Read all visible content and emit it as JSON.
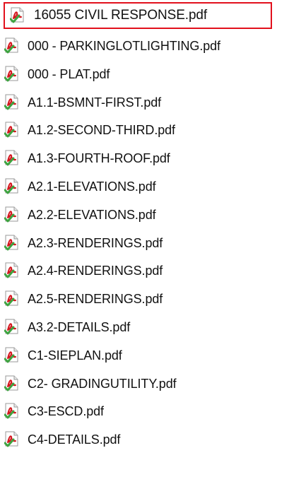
{
  "highlight_color": "#e2101c",
  "icon": {
    "name": "pdf-file-icon",
    "page_color": "#ffffff",
    "page_border": "#9a9a9a",
    "acrobat_red": "#d4181f",
    "sync_check_green": "#3ea340"
  },
  "highlighted_file": {
    "name": "16055 CIVIL RESPONSE.pdf"
  },
  "files": [
    {
      "name": "000 - PARKINGLOTLIGHTING.pdf"
    },
    {
      "name": "000 - PLAT.pdf"
    },
    {
      "name": "A1.1-BSMNT-FIRST.pdf"
    },
    {
      "name": "A1.2-SECOND-THIRD.pdf"
    },
    {
      "name": "A1.3-FOURTH-ROOF.pdf"
    },
    {
      "name": "A2.1-ELEVATIONS.pdf"
    },
    {
      "name": "A2.2-ELEVATIONS.pdf"
    },
    {
      "name": "A2.3-RENDERINGS.pdf"
    },
    {
      "name": "A2.4-RENDERINGS.pdf"
    },
    {
      "name": "A2.5-RENDERINGS.pdf"
    },
    {
      "name": "A3.2-DETAILS.pdf"
    },
    {
      "name": "C1-SIEPLAN.pdf"
    },
    {
      "name": "C2- GRADINGUTILITY.pdf"
    },
    {
      "name": "C3-ESCD.pdf"
    },
    {
      "name": "C4-DETAILS.pdf"
    }
  ]
}
